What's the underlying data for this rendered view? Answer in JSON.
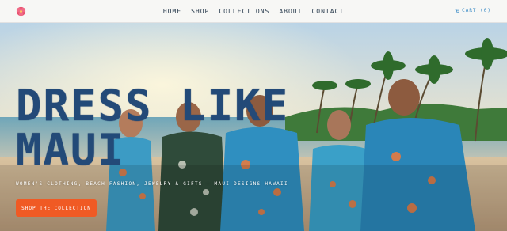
{
  "header": {
    "nav": [
      "HOME",
      "SHOP",
      "COLLECTIONS",
      "ABOUT",
      "CONTACT"
    ],
    "cart_label": "CART (0)",
    "logo_icon": "hibiscus-logo-icon"
  },
  "hero": {
    "title_line1": "DRESS LIKE",
    "title_line2": "MAUI",
    "subtitle": "WOMEN'S CLOTHING, BEACH FASHION, JEWELRY & GIFTS — MAUI DESIGNS HAWAII",
    "cta_label": "SHOP THE COLLECTION",
    "image": "group of people in tropical aloha shirts laughing on beach with palm trees"
  },
  "colors": {
    "accent": "#f05a24",
    "title": "#234a78",
    "nav_text": "#2c3e50"
  }
}
